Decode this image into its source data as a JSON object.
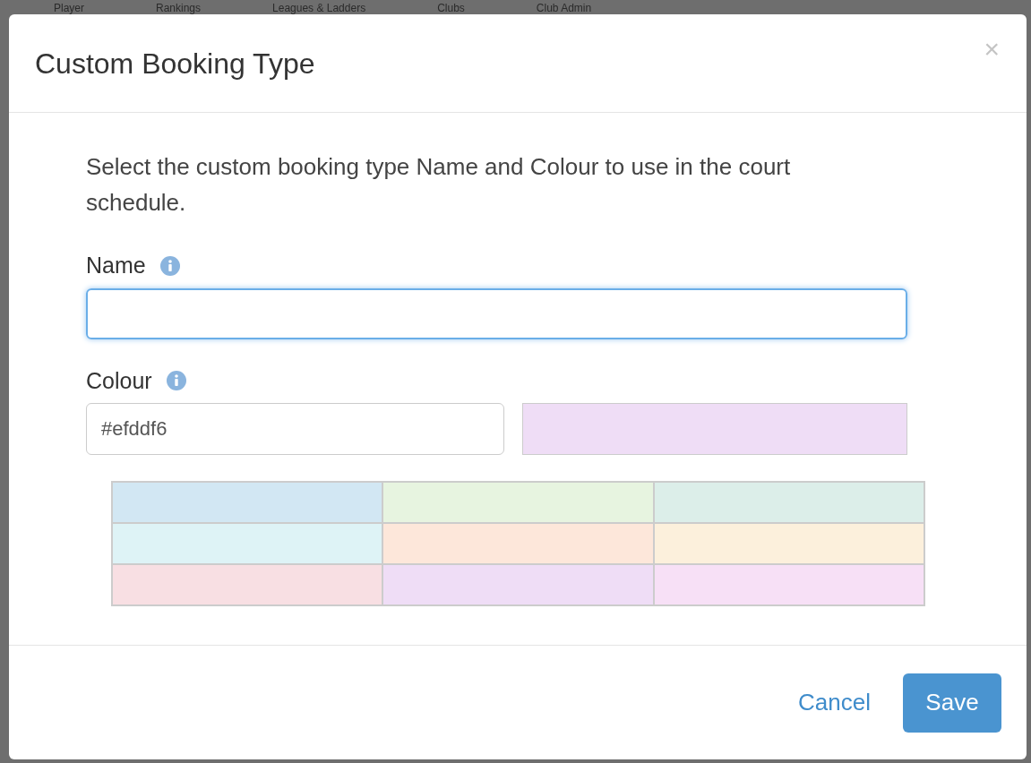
{
  "background_nav": [
    "Player",
    "Rankings",
    "Leagues & Ladders",
    "Clubs",
    "Club Admin"
  ],
  "dialog": {
    "title": "Custom Booking Type",
    "close": "×",
    "intro": "Select the custom booking type Name and Colour to use in the court schedule.",
    "name_field": {
      "label": "Name",
      "focused": true
    },
    "colour_field": {
      "label": "Colour",
      "value": "#efddf6"
    },
    "swatches": [
      {
        "color": "#d2e7f3"
      },
      {
        "color": "#e7f4e0"
      },
      {
        "color": "#dceee9"
      },
      {
        "color": "#def3f6"
      },
      {
        "color": "#fde7da"
      },
      {
        "color": "#fcf0dc"
      },
      {
        "color": "#f8dfe3"
      },
      {
        "color": "#efddf6"
      },
      {
        "color": "#f7e0f6"
      }
    ],
    "buttons": {
      "cancel": "Cancel",
      "save": "Save"
    }
  }
}
